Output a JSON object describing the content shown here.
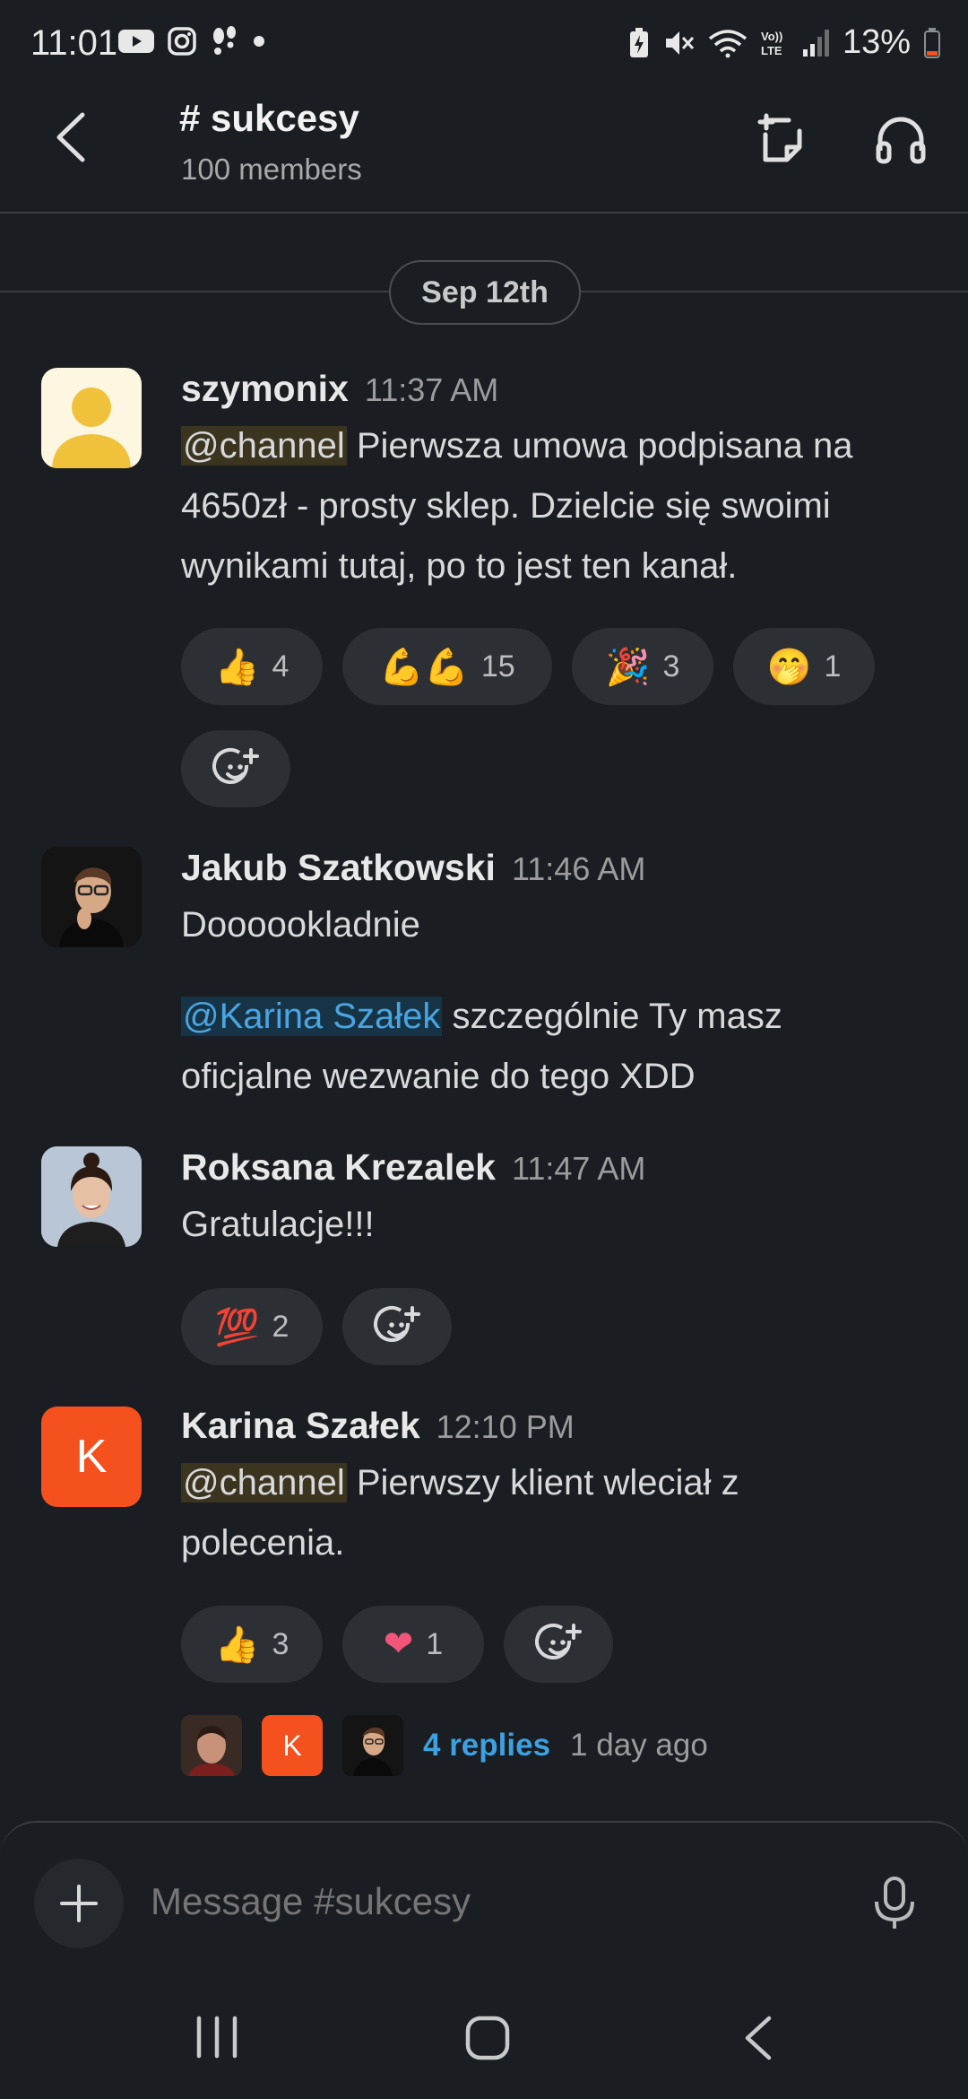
{
  "status_bar": {
    "time": "11:01",
    "battery": "13%"
  },
  "header": {
    "channel": "# sukcesy",
    "members": "100 members"
  },
  "date_divider": "Sep 12th",
  "messages": [
    {
      "author": "szymonix",
      "time": "11:37 AM",
      "mention": "@channel",
      "text_line1": " Pierwsza umowa podpisana na",
      "text_line2": "4650zł - prosty sklep. Dzielcie się swoimi",
      "text_line3": "wynikami tutaj, po to jest ten kanał.",
      "reactions": [
        {
          "emoji": "👍",
          "count": "4"
        },
        {
          "emoji": "💪💪",
          "count": "15"
        },
        {
          "emoji": "🎉",
          "count": "3"
        },
        {
          "emoji": "🤭",
          "count": "1"
        }
      ]
    },
    {
      "author": "Jakub Szatkowski",
      "time": "11:46 AM",
      "text_line1": "Doooookladnie",
      "mention": "@Karina Szałek",
      "text_line2": " szczególnie Ty masz",
      "text_line3": "oficjalne wezwanie do tego XDD"
    },
    {
      "author": "Roksana Krezalek",
      "time": "11:47 AM",
      "text_line1": "Gratulacje!!!",
      "reactions": [
        {
          "emoji": "💯",
          "count": "2"
        }
      ]
    },
    {
      "author": "Karina Szałek",
      "time": "12:10 PM",
      "avatar_letter": "K",
      "mention": "@channel",
      "text_line1": " Pierwszy klient wleciał z",
      "text_line2": "polecenia.",
      "reactions": [
        {
          "emoji": "👍",
          "count": "3"
        },
        {
          "emoji": "❤",
          "count": "1"
        }
      ],
      "thread": {
        "avatar_letter": "K",
        "replies": "4 replies",
        "ago": "1 day ago"
      }
    }
  ],
  "composer": {
    "placeholder": "Message #sukcesy"
  },
  "colors": {
    "background": "#1a1d21",
    "accent_blue": "#3ca1e1",
    "avatar_orange": "#f4511e"
  }
}
